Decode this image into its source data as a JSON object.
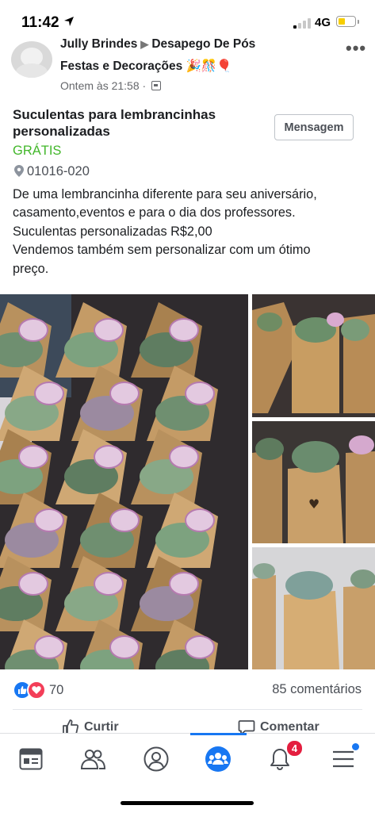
{
  "status_bar": {
    "time": "11:42",
    "network": "4G"
  },
  "post": {
    "group_line1_author": "Jully Brindes",
    "group_line1_group": "Desapego De Pós",
    "group_line2": "Festas e Decorações 🎉🎊🎈",
    "timestamp": "Ontem às 21:58 ·",
    "title": "Suculentas para lembrancinhas personalizadas",
    "message_button": "Mensagem",
    "price": "GRÁTIS",
    "location": "01016-020",
    "description_lines": [
      "De uma lembrancinha diferente para seu aniversário,",
      "casamento,eventos e para o dia dos professores.",
      "Suculentas personalizadas R$2,00",
      "Vendemos também sem personalizar  com um ótimo",
      "preço."
    ]
  },
  "reactions": {
    "count": "70",
    "comments": "85 comentários"
  },
  "actions": {
    "like": "Curtir",
    "comment": "Comentar"
  },
  "nav": {
    "notification_badge": "4"
  },
  "colors": {
    "accent": "#1877f2",
    "price": "#42b72a",
    "badge": "#e41e3f"
  },
  "icons": [
    "location-arrow-icon",
    "signal-icon",
    "battery-icon",
    "more-options-icon",
    "privacy-icon",
    "pin-icon",
    "like-reaction-icon",
    "love-reaction-icon",
    "thumbs-up-icon",
    "comment-icon",
    "news-feed-icon",
    "friends-icon",
    "profile-icon",
    "groups-icon",
    "bell-icon",
    "menu-icon"
  ]
}
